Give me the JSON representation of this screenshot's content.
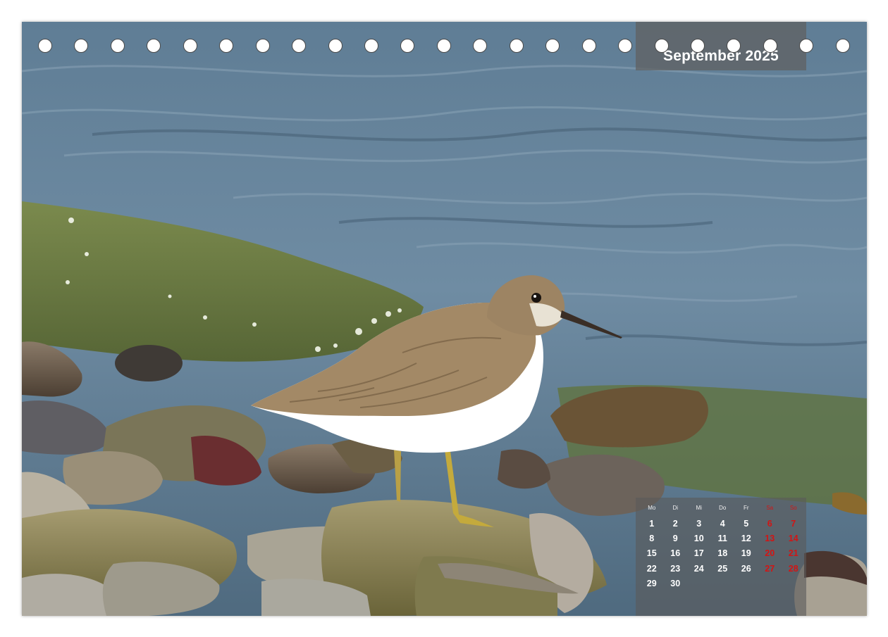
{
  "calendar": {
    "month_title": "September 2025",
    "weekdays": [
      "Mo",
      "Di",
      "Mi",
      "Do",
      "Fr",
      "Sa",
      "So"
    ],
    "weekend_color": "#d31414",
    "weeks": [
      [
        "1",
        "2",
        "3",
        "4",
        "5",
        "6",
        "7"
      ],
      [
        "8",
        "9",
        "10",
        "11",
        "12",
        "13",
        "14"
      ],
      [
        "15",
        "16",
        "17",
        "18",
        "19",
        "20",
        "21"
      ],
      [
        "22",
        "23",
        "24",
        "25",
        "26",
        "27",
        "28"
      ],
      [
        "29",
        "30",
        "",
        "",
        "",
        "",
        ""
      ]
    ]
  }
}
